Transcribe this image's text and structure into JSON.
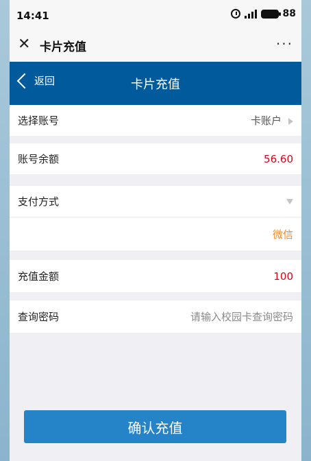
{
  "status": {
    "time": "14:41",
    "battery": "88"
  },
  "app": {
    "title": "卡片充值"
  },
  "header": {
    "back_label": "返回",
    "title": "卡片充值"
  },
  "form": {
    "account": {
      "label": "选择账号",
      "value": "卡账户"
    },
    "balance": {
      "label": "账号余额",
      "value": "56.60"
    },
    "payment": {
      "label": "支付方式",
      "value": "微信"
    },
    "amount": {
      "label": "充值金额",
      "value": "100"
    },
    "password": {
      "label": "查询密码",
      "placeholder": "请输入校园卡查询密码"
    }
  },
  "buttons": {
    "confirm": "确认充值"
  },
  "colors": {
    "header": "#005a9c",
    "button": "#2583c8",
    "amount_red": "#d2081b",
    "wechat_orange": "#ef8a25"
  }
}
